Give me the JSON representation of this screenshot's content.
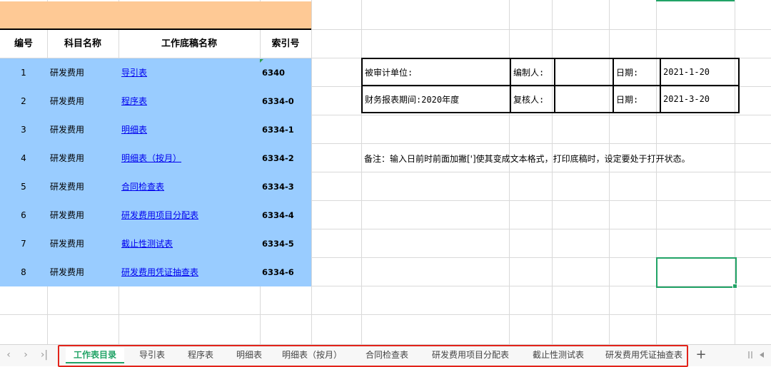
{
  "table": {
    "headers": {
      "num": "编号",
      "subject": "科目名称",
      "name": "工作底稿名称",
      "index": "索引号"
    },
    "rows": [
      {
        "num": "1",
        "subject": "研发费用",
        "name": "导引表",
        "index": "6340"
      },
      {
        "num": "2",
        "subject": "研发费用",
        "name": "程序表",
        "index": "6334-0"
      },
      {
        "num": "3",
        "subject": "研发费用",
        "name": "明细表",
        "index": "6334-1"
      },
      {
        "num": "4",
        "subject": "研发费用",
        "name": "明细表（按月）",
        "index": "6334-2"
      },
      {
        "num": "5",
        "subject": "研发费用",
        "name": "合同检查表",
        "index": "6334-3"
      },
      {
        "num": "6",
        "subject": "研发费用",
        "name": "研发费用项目分配表",
        "index": "6334-4"
      },
      {
        "num": "7",
        "subject": "研发费用",
        "name": "截止性测试表",
        "index": "6334-5"
      },
      {
        "num": "8",
        "subject": "研发费用",
        "name": "研发费用凭证抽查表",
        "index": "6334-6"
      }
    ]
  },
  "info": {
    "auditee_label": "被审计单位:",
    "preparer_label": "编制人:",
    "date_label_1": "日期:",
    "date_1": "2021-1-20",
    "period_label": "财务报表期间:2020年度",
    "reviewer_label": "复核人:",
    "date_label_2": "日期:",
    "date_2": "2021-3-20"
  },
  "note": "备注：输入日前时前面加撇[']使其变成文本格式，打印底稿时，设定要处于打开状态。",
  "sheet_tabs": [
    "工作表目录",
    "导引表",
    "程序表",
    "明细表",
    "明细表（按月）",
    "合同检查表",
    "研发费用项目分配表",
    "截止性测试表",
    "研发费用凭证抽查表"
  ],
  "active_tab": "工作表目录",
  "colors": {
    "header_band": "#fec995",
    "table_fill": "#99ccff",
    "accent": "#21a366",
    "highlight": "#e2231a"
  }
}
